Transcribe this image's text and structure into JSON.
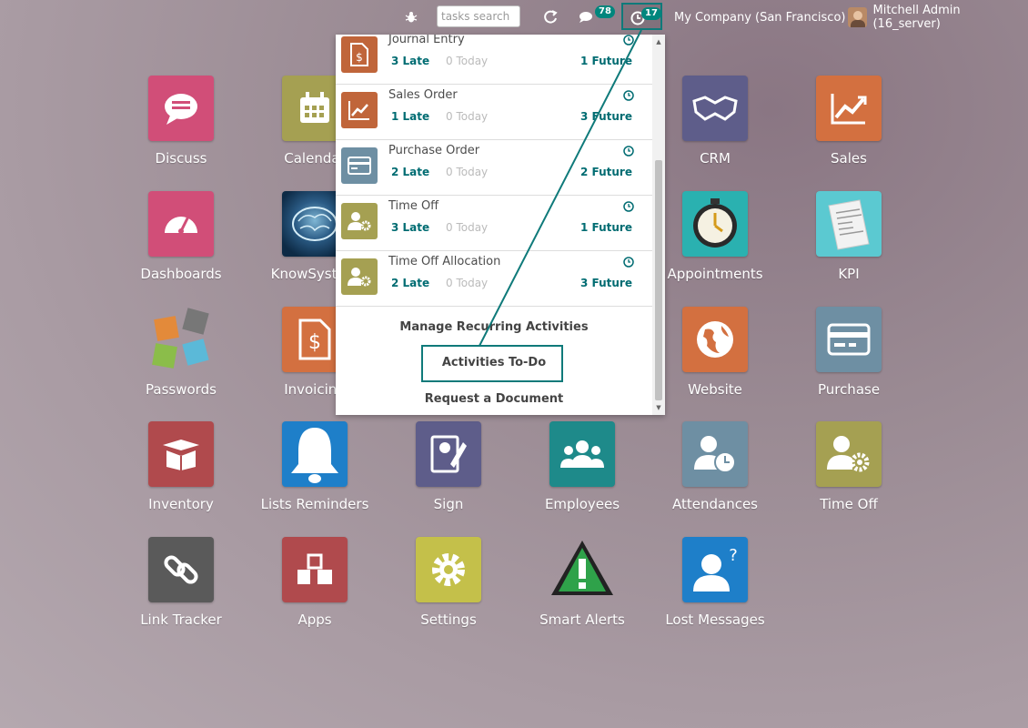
{
  "topbar": {
    "search_placeholder": "tasks search",
    "messages_count": "78",
    "activities_count": "17",
    "company": "My Company (San Francisco)",
    "user": "Mitchell Admin (16_server)"
  },
  "apps": [
    {
      "label": "Discuss",
      "icon": "chat-icon",
      "color": "#d14e78"
    },
    {
      "label": "Calendar",
      "icon": "calendar-icon",
      "color": "#a5a052"
    },
    {
      "label": "CRM",
      "icon": "handshake-icon",
      "color": "#5e5d8a"
    },
    {
      "label": "Sales",
      "icon": "chart-up-icon",
      "color": "#d37040"
    },
    {
      "label": "Dashboards",
      "icon": "gauge-icon",
      "color": "#d14e78"
    },
    {
      "label": "KnowSystem",
      "icon": "brain-icon",
      "color": "#0d2a45"
    },
    {
      "label": "Appointments",
      "icon": "stopwatch-icon",
      "color": "#2ab1b0"
    },
    {
      "label": "KPI",
      "icon": "newspaper-icon",
      "color": "#5bc9d1"
    },
    {
      "label": "Passwords",
      "icon": "puzzle-icon",
      "color": "transparent"
    },
    {
      "label": "Invoicing",
      "icon": "invoice-icon",
      "color": "#d37040"
    },
    {
      "label": "Website",
      "icon": "globe-icon",
      "color": "#d37040"
    },
    {
      "label": "Purchase",
      "icon": "credit-card-icon",
      "color": "#6e8fa3"
    },
    {
      "label": "Inventory",
      "icon": "box-icon",
      "color": "#b04a4d"
    },
    {
      "label": "Lists Reminders",
      "icon": "bell-icon",
      "color": "#1e7fc9"
    },
    {
      "label": "Sign",
      "icon": "sign-icon",
      "color": "#5e5d8a"
    },
    {
      "label": "Employees",
      "icon": "people-icon",
      "color": "#1e8a8a"
    },
    {
      "label": "Attendances",
      "icon": "user-clock-icon",
      "color": "#6e8fa3"
    },
    {
      "label": "Time Off",
      "icon": "user-gear-icon",
      "color": "#a5a052"
    },
    {
      "label": "Link Tracker",
      "icon": "link-icon",
      "color": "#5a5a5a"
    },
    {
      "label": "Apps",
      "icon": "cubes-icon",
      "color": "#b04a4d"
    },
    {
      "label": "Settings",
      "icon": "gear-icon",
      "color": "#c4c04a"
    },
    {
      "label": "Smart Alerts",
      "icon": "alert-icon",
      "color": "transparent"
    },
    {
      "label": "Lost Messages",
      "icon": "user-question-icon",
      "color": "#1e7fc9"
    }
  ],
  "activities": [
    {
      "name": "Journal Entry",
      "late": "3 Late",
      "today": "0 Today",
      "future": "1 Future",
      "color": "#c0653a"
    },
    {
      "name": "Sales Order",
      "late": "1 Late",
      "today": "0 Today",
      "future": "3 Future",
      "color": "#c0653a"
    },
    {
      "name": "Purchase Order",
      "late": "2 Late",
      "today": "0 Today",
      "future": "2 Future",
      "color": "#6e8fa3"
    },
    {
      "name": "Time Off",
      "late": "3 Late",
      "today": "0 Today",
      "future": "1 Future",
      "color": "#a5a052"
    },
    {
      "name": "Time Off Allocation",
      "late": "2 Late",
      "today": "0 Today",
      "future": "3 Future",
      "color": "#a5a052"
    }
  ],
  "dropdown_links": {
    "manage": "Manage Recurring Activities",
    "todo": "Activities To-Do",
    "request": "Request a Document"
  }
}
